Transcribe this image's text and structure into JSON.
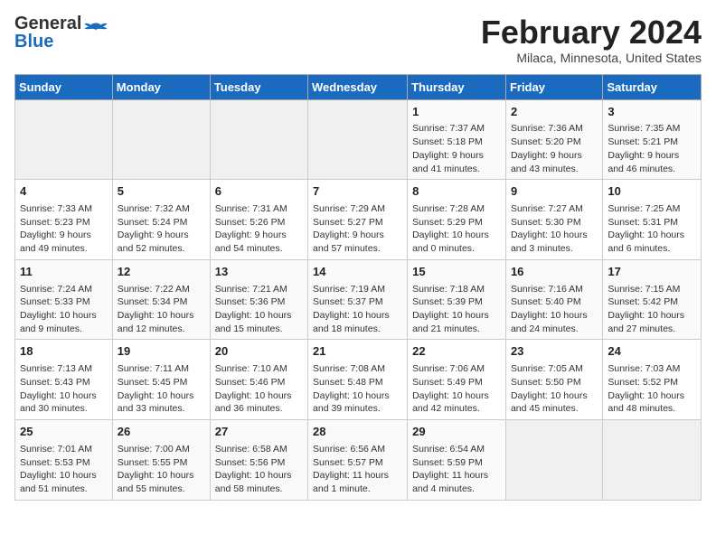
{
  "header": {
    "logo_general": "General",
    "logo_blue": "Blue",
    "month_year": "February 2024",
    "location": "Milaca, Minnesota, United States"
  },
  "days_of_week": [
    "Sunday",
    "Monday",
    "Tuesday",
    "Wednesday",
    "Thursday",
    "Friday",
    "Saturday"
  ],
  "weeks": [
    [
      {
        "day": "",
        "detail": ""
      },
      {
        "day": "",
        "detail": ""
      },
      {
        "day": "",
        "detail": ""
      },
      {
        "day": "",
        "detail": ""
      },
      {
        "day": "1",
        "detail": "Sunrise: 7:37 AM\nSunset: 5:18 PM\nDaylight: 9 hours\nand 41 minutes."
      },
      {
        "day": "2",
        "detail": "Sunrise: 7:36 AM\nSunset: 5:20 PM\nDaylight: 9 hours\nand 43 minutes."
      },
      {
        "day": "3",
        "detail": "Sunrise: 7:35 AM\nSunset: 5:21 PM\nDaylight: 9 hours\nand 46 minutes."
      }
    ],
    [
      {
        "day": "4",
        "detail": "Sunrise: 7:33 AM\nSunset: 5:23 PM\nDaylight: 9 hours\nand 49 minutes."
      },
      {
        "day": "5",
        "detail": "Sunrise: 7:32 AM\nSunset: 5:24 PM\nDaylight: 9 hours\nand 52 minutes."
      },
      {
        "day": "6",
        "detail": "Sunrise: 7:31 AM\nSunset: 5:26 PM\nDaylight: 9 hours\nand 54 minutes."
      },
      {
        "day": "7",
        "detail": "Sunrise: 7:29 AM\nSunset: 5:27 PM\nDaylight: 9 hours\nand 57 minutes."
      },
      {
        "day": "8",
        "detail": "Sunrise: 7:28 AM\nSunset: 5:29 PM\nDaylight: 10 hours\nand 0 minutes."
      },
      {
        "day": "9",
        "detail": "Sunrise: 7:27 AM\nSunset: 5:30 PM\nDaylight: 10 hours\nand 3 minutes."
      },
      {
        "day": "10",
        "detail": "Sunrise: 7:25 AM\nSunset: 5:31 PM\nDaylight: 10 hours\nand 6 minutes."
      }
    ],
    [
      {
        "day": "11",
        "detail": "Sunrise: 7:24 AM\nSunset: 5:33 PM\nDaylight: 10 hours\nand 9 minutes."
      },
      {
        "day": "12",
        "detail": "Sunrise: 7:22 AM\nSunset: 5:34 PM\nDaylight: 10 hours\nand 12 minutes."
      },
      {
        "day": "13",
        "detail": "Sunrise: 7:21 AM\nSunset: 5:36 PM\nDaylight: 10 hours\nand 15 minutes."
      },
      {
        "day": "14",
        "detail": "Sunrise: 7:19 AM\nSunset: 5:37 PM\nDaylight: 10 hours\nand 18 minutes."
      },
      {
        "day": "15",
        "detail": "Sunrise: 7:18 AM\nSunset: 5:39 PM\nDaylight: 10 hours\nand 21 minutes."
      },
      {
        "day": "16",
        "detail": "Sunrise: 7:16 AM\nSunset: 5:40 PM\nDaylight: 10 hours\nand 24 minutes."
      },
      {
        "day": "17",
        "detail": "Sunrise: 7:15 AM\nSunset: 5:42 PM\nDaylight: 10 hours\nand 27 minutes."
      }
    ],
    [
      {
        "day": "18",
        "detail": "Sunrise: 7:13 AM\nSunset: 5:43 PM\nDaylight: 10 hours\nand 30 minutes."
      },
      {
        "day": "19",
        "detail": "Sunrise: 7:11 AM\nSunset: 5:45 PM\nDaylight: 10 hours\nand 33 minutes."
      },
      {
        "day": "20",
        "detail": "Sunrise: 7:10 AM\nSunset: 5:46 PM\nDaylight: 10 hours\nand 36 minutes."
      },
      {
        "day": "21",
        "detail": "Sunrise: 7:08 AM\nSunset: 5:48 PM\nDaylight: 10 hours\nand 39 minutes."
      },
      {
        "day": "22",
        "detail": "Sunrise: 7:06 AM\nSunset: 5:49 PM\nDaylight: 10 hours\nand 42 minutes."
      },
      {
        "day": "23",
        "detail": "Sunrise: 7:05 AM\nSunset: 5:50 PM\nDaylight: 10 hours\nand 45 minutes."
      },
      {
        "day": "24",
        "detail": "Sunrise: 7:03 AM\nSunset: 5:52 PM\nDaylight: 10 hours\nand 48 minutes."
      }
    ],
    [
      {
        "day": "25",
        "detail": "Sunrise: 7:01 AM\nSunset: 5:53 PM\nDaylight: 10 hours\nand 51 minutes."
      },
      {
        "day": "26",
        "detail": "Sunrise: 7:00 AM\nSunset: 5:55 PM\nDaylight: 10 hours\nand 55 minutes."
      },
      {
        "day": "27",
        "detail": "Sunrise: 6:58 AM\nSunset: 5:56 PM\nDaylight: 10 hours\nand 58 minutes."
      },
      {
        "day": "28",
        "detail": "Sunrise: 6:56 AM\nSunset: 5:57 PM\nDaylight: 11 hours\nand 1 minute."
      },
      {
        "day": "29",
        "detail": "Sunrise: 6:54 AM\nSunset: 5:59 PM\nDaylight: 11 hours\nand 4 minutes."
      },
      {
        "day": "",
        "detail": ""
      },
      {
        "day": "",
        "detail": ""
      }
    ]
  ]
}
